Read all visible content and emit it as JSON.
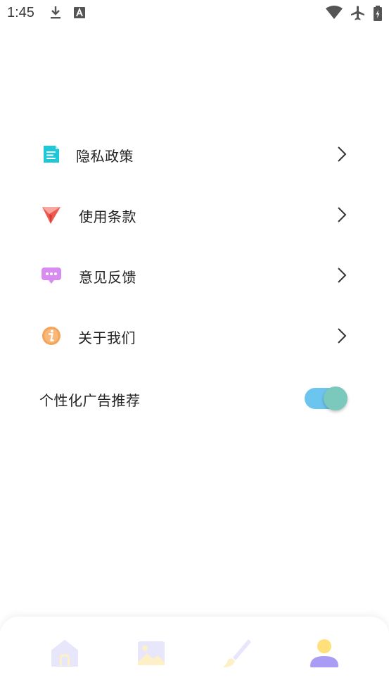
{
  "status_bar": {
    "time": "1:45",
    "icons": [
      "download-icon",
      "font-a-icon",
      "wifi-icon",
      "airplane-icon",
      "battery-charging-icon"
    ]
  },
  "menu": {
    "items": [
      {
        "label": "隐私政策",
        "icon": "document-icon",
        "color": "#1ec8d6"
      },
      {
        "label": "使用条款",
        "icon": "paper-plane-icon",
        "color": "#f0584f"
      },
      {
        "label": "意见反馈",
        "icon": "chat-bubble-icon",
        "color": "#d98cf0"
      },
      {
        "label": "关于我们",
        "icon": "info-icon",
        "color": "#f5a35a"
      }
    ]
  },
  "settings": {
    "personalized_ads_label": "个性化广告推荐",
    "personalized_ads_enabled": true
  },
  "bottom_nav": {
    "items": [
      {
        "name": "home",
        "icon": "home-icon",
        "active": false
      },
      {
        "name": "gallery",
        "icon": "image-icon",
        "active": false
      },
      {
        "name": "paint",
        "icon": "brush-icon",
        "active": false
      },
      {
        "name": "profile",
        "icon": "user-icon",
        "active": true
      }
    ]
  },
  "colors": {
    "accent": "#6cc5ef",
    "toggle_knob": "#7bc9bd",
    "profile_active": "#a99cf5",
    "profile_head": "#ffe07a"
  }
}
